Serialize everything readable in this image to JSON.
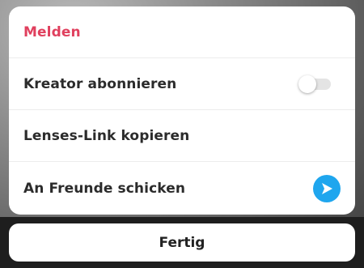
{
  "menu": {
    "items": [
      {
        "label": "Melden"
      },
      {
        "label": "Kreator abonnieren",
        "toggle_on": false
      },
      {
        "label": "Lenses-Link kopieren"
      },
      {
        "label": "An Freunde schicken",
        "icon": "send-arrow-icon"
      }
    ]
  },
  "done_button": {
    "label": "Fertig"
  },
  "colors": {
    "danger": "#e0405e",
    "accent": "#1fa6ee"
  }
}
